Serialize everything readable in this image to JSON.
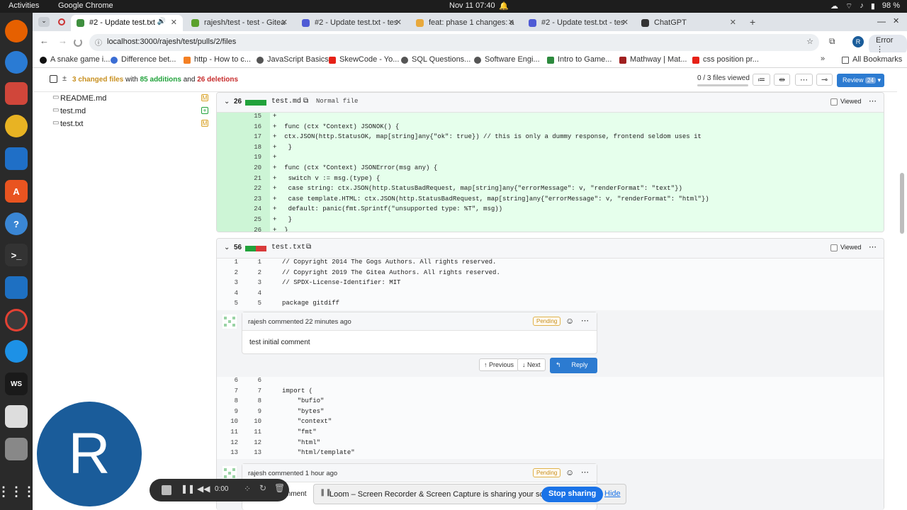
{
  "system": {
    "activities": "Activities",
    "app": "Google Chrome",
    "clock": "Nov 11  07:40",
    "battery": "98 %"
  },
  "tabs": [
    {
      "title": "#2 - Update test.txt",
      "active": true,
      "color": "#3f8f3f"
    },
    {
      "title": "rajesh/test - test - Gitea",
      "active": false,
      "color": "#5aa02c"
    },
    {
      "title": "#2 - Update test.txt - tes",
      "active": false,
      "color": "#4f5bd5"
    },
    {
      "title": "feat: phase 1 changes: a",
      "active": false,
      "color": "#e8a93c"
    },
    {
      "title": "#2 - Update test.txt - tes",
      "active": false,
      "color": "#4f5bd5"
    },
    {
      "title": "ChatGPT",
      "active": false,
      "color": "#333333"
    }
  ],
  "omnibox": {
    "url": "localhost:3000/rajesh/test/pulls/2/files",
    "profile": "R",
    "error": "Error"
  },
  "bookmarks": [
    "A snake game i...",
    "Difference bet...",
    "http - How to c...",
    "JavaScript Basics",
    "SkewCode - Yo...",
    "SQL Questions...",
    "Software Engi...",
    "Intro to Game...",
    "Mathway | Mat...",
    "css position pr..."
  ],
  "bookmarks_all": "All Bookmarks",
  "diffbar": {
    "changed": "3 changed files",
    "with": "with",
    "additions": "85 additions",
    "and": "and",
    "deletions": "26 deletions",
    "viewed": "0 / 3 files viewed",
    "review": "Review",
    "review_count": "24"
  },
  "files": [
    {
      "name": "README.md",
      "status": "M"
    },
    {
      "name": "test.md",
      "status": "+"
    },
    {
      "name": "test.txt",
      "status": "M"
    }
  ],
  "file1": {
    "count": "26",
    "name": "test.md",
    "mode": "Normal file",
    "viewed": "Viewed",
    "lines": [
      {
        "n": "15",
        "t": "+"
      },
      {
        "n": "16",
        "t": "+  func (ctx *Context) JSONOK() {"
      },
      {
        "n": "17",
        "t": "+  ctx.JSON(http.StatusOK, map[string]any{\"ok\": true}) // this is only a dummy response, frontend seldom uses it"
      },
      {
        "n": "18",
        "t": "+   }"
      },
      {
        "n": "19",
        "t": "+"
      },
      {
        "n": "20",
        "t": "+  func (ctx *Context) JSONError(msg any) {"
      },
      {
        "n": "21",
        "t": "+   switch v := msg.(type) {"
      },
      {
        "n": "22",
        "t": "+   case string: ctx.JSON(http.StatusBadRequest, map[string]any{\"errorMessage\": v, \"renderFormat\": \"text\"})"
      },
      {
        "n": "23",
        "t": "+   case template.HTML: ctx.JSON(http.StatusBadRequest, map[string]any{\"errorMessage\": v, \"renderFormat\": \"html\"})"
      },
      {
        "n": "24",
        "t": "+   default: panic(fmt.Sprintf(\"unsupported type: %T\", msg))"
      },
      {
        "n": "25",
        "t": "+   }"
      },
      {
        "n": "26",
        "t": "+  }"
      }
    ]
  },
  "file2": {
    "count": "56",
    "name": "test.txt",
    "viewed": "Viewed",
    "lines_a": [
      {
        "o": "1",
        "n": "1",
        "t": "// Copyright 2014 The Gogs Authors. All rights reserved."
      },
      {
        "o": "2",
        "n": "2",
        "t": "// Copyright 2019 The Gitea Authors. All rights reserved."
      },
      {
        "o": "3",
        "n": "3",
        "t": "// SPDX-License-Identifier: MIT"
      },
      {
        "o": "4",
        "n": "4",
        "t": ""
      },
      {
        "o": "5",
        "n": "5",
        "t": "package gitdiff"
      }
    ],
    "lines_b": [
      {
        "o": "6",
        "n": "6",
        "t": ""
      },
      {
        "o": "7",
        "n": "7",
        "t": "import ("
      },
      {
        "o": "8",
        "n": "8",
        "t": "    \"bufio\""
      },
      {
        "o": "9",
        "n": "9",
        "t": "    \"bytes\""
      },
      {
        "o": "10",
        "n": "10",
        "t": "    \"context\""
      },
      {
        "o": "11",
        "n": "11",
        "t": "    \"fmt\""
      },
      {
        "o": "12",
        "n": "12",
        "t": "    \"html\""
      },
      {
        "o": "13",
        "n": "13",
        "t": "    \"html/template\""
      }
    ]
  },
  "comment1": {
    "author": "rajesh commented 22 minutes ago",
    "badge": "Pending",
    "body": "test initial comment",
    "prev": "Previous",
    "next": "Next",
    "reply": "Reply"
  },
  "comment2": {
    "author": "rajesh commented 1 hour ago",
    "badge": "Pending",
    "body": "mment"
  },
  "loom": {
    "time": "0:00"
  },
  "share": {
    "text": "Loom – Screen Recorder & Screen Capture is sharing your screen.",
    "stop": "Stop sharing",
    "hide": "Hide"
  },
  "avatar_letter": "R"
}
